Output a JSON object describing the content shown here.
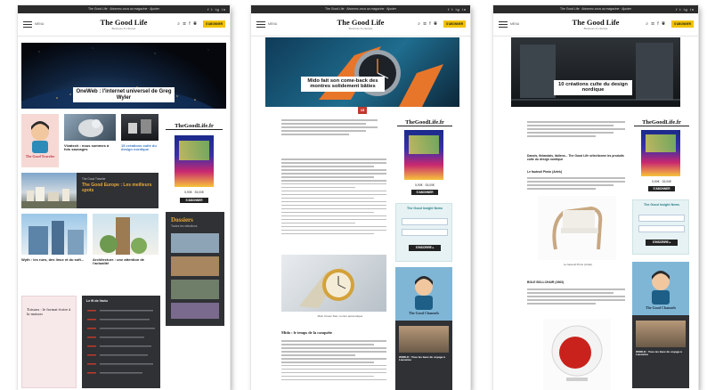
{
  "site": {
    "topbar_text": "The Good Life · Abonnez-vous au magazine · Ajouter",
    "social_icons": "f t ig in",
    "menu_label": "MENU",
    "logo": "The Good Life",
    "tagline": "Business & Lifestyle",
    "header_icons": "⌕ ✉ f ◉",
    "subscribe_label": "S'ABONNER"
  },
  "page1": {
    "hero_title": "OneWeb : l'internet universel de Greg Wyler",
    "row1": [
      {
        "title": "The Good Traveler",
        "type": "illustration"
      },
      {
        "title": "Vivatech : nous sommes à fois sauvages",
        "type": "photo"
      },
      {
        "title": "15 créations culte du design nordique",
        "type": "photo"
      }
    ],
    "featured_kicker": "The Good Traveler",
    "featured_title": "The Good Europe : Les meilleurs spots",
    "row2": [
      {
        "title": "Wyth : les rues, des lieux et du soft..."
      },
      {
        "title": "Architecture : une attention de l'actualité"
      }
    ],
    "dossiers_label": "Dossiers",
    "dossiers_sub": "Toutes les sélections",
    "quote_title": "Toisons : le format écrire à la maison",
    "dark_list_heading": "Le fil de l'actu",
    "sidebar": {
      "brand": "TheGoodLife.fr",
      "price": "5,90€ · 35,00€",
      "button": "S'ABONNER"
    }
  },
  "page2": {
    "hero_title": "Mido fait son come-back des montres solidement bâties",
    "hero_badge": "15",
    "section_heading": "Mido : le temps de la conquête",
    "photo_caption": "Mido Ocean Star, montre automatique",
    "sidebar": {
      "brand": "TheGoodLife.fr",
      "price": "5,90€ · 35,00€",
      "button": "S'ABONNER",
      "newsletter_title": "The Good Insight News",
      "newsletter_button": "S'INSCRIRE ▸",
      "hub_title": "The Good Channels",
      "hub_story": "WORLD : Tous les lieux du voyage à Lausanne"
    }
  },
  "page3": {
    "hero_title": "10 créations culte du design nordique",
    "intro_bold": "Les produits iconiques du design scandinave vers la culture",
    "list_heading": "Danois, finlandais, italiens... The Good Life sélectionne les produits culte du design nordique",
    "item1": "Le fauteuil Pimio (Artek)",
    "item2": "BOLE BOLLCHAIR (1963)",
    "sidebar": {
      "brand": "TheGoodLife.fr",
      "price": "5,90€ · 35,00€",
      "button": "S'ABONNER",
      "newsletter_title": "The Good Insight News",
      "newsletter_button": "S'INSCRIRE ▸",
      "hub_title": "The Good Channels",
      "hub_story": "WORLD : Tous les lieux du voyage à Lausanne"
    }
  }
}
